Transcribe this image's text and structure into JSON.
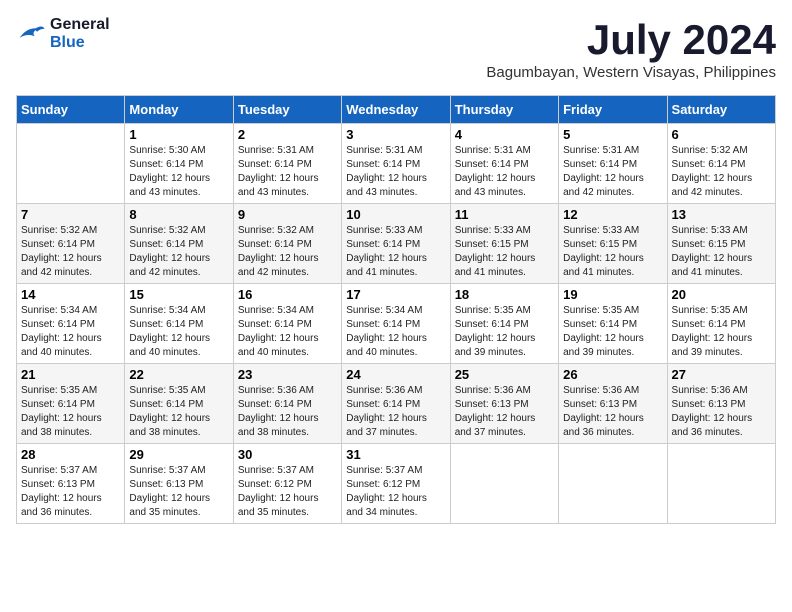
{
  "header": {
    "logo_line1": "General",
    "logo_line2": "Blue",
    "month_title": "July 2024",
    "location": "Bagumbayan, Western Visayas, Philippines"
  },
  "columns": [
    "Sunday",
    "Monday",
    "Tuesday",
    "Wednesday",
    "Thursday",
    "Friday",
    "Saturday"
  ],
  "weeks": [
    [
      {
        "day": "",
        "info": ""
      },
      {
        "day": "1",
        "info": "Sunrise: 5:30 AM\nSunset: 6:14 PM\nDaylight: 12 hours\nand 43 minutes."
      },
      {
        "day": "2",
        "info": "Sunrise: 5:31 AM\nSunset: 6:14 PM\nDaylight: 12 hours\nand 43 minutes."
      },
      {
        "day": "3",
        "info": "Sunrise: 5:31 AM\nSunset: 6:14 PM\nDaylight: 12 hours\nand 43 minutes."
      },
      {
        "day": "4",
        "info": "Sunrise: 5:31 AM\nSunset: 6:14 PM\nDaylight: 12 hours\nand 43 minutes."
      },
      {
        "day": "5",
        "info": "Sunrise: 5:31 AM\nSunset: 6:14 PM\nDaylight: 12 hours\nand 42 minutes."
      },
      {
        "day": "6",
        "info": "Sunrise: 5:32 AM\nSunset: 6:14 PM\nDaylight: 12 hours\nand 42 minutes."
      }
    ],
    [
      {
        "day": "7",
        "info": "Sunrise: 5:32 AM\nSunset: 6:14 PM\nDaylight: 12 hours\nand 42 minutes."
      },
      {
        "day": "8",
        "info": "Sunrise: 5:32 AM\nSunset: 6:14 PM\nDaylight: 12 hours\nand 42 minutes."
      },
      {
        "day": "9",
        "info": "Sunrise: 5:32 AM\nSunset: 6:14 PM\nDaylight: 12 hours\nand 42 minutes."
      },
      {
        "day": "10",
        "info": "Sunrise: 5:33 AM\nSunset: 6:14 PM\nDaylight: 12 hours\nand 41 minutes."
      },
      {
        "day": "11",
        "info": "Sunrise: 5:33 AM\nSunset: 6:15 PM\nDaylight: 12 hours\nand 41 minutes."
      },
      {
        "day": "12",
        "info": "Sunrise: 5:33 AM\nSunset: 6:15 PM\nDaylight: 12 hours\nand 41 minutes."
      },
      {
        "day": "13",
        "info": "Sunrise: 5:33 AM\nSunset: 6:15 PM\nDaylight: 12 hours\nand 41 minutes."
      }
    ],
    [
      {
        "day": "14",
        "info": "Sunrise: 5:34 AM\nSunset: 6:14 PM\nDaylight: 12 hours\nand 40 minutes."
      },
      {
        "day": "15",
        "info": "Sunrise: 5:34 AM\nSunset: 6:14 PM\nDaylight: 12 hours\nand 40 minutes."
      },
      {
        "day": "16",
        "info": "Sunrise: 5:34 AM\nSunset: 6:14 PM\nDaylight: 12 hours\nand 40 minutes."
      },
      {
        "day": "17",
        "info": "Sunrise: 5:34 AM\nSunset: 6:14 PM\nDaylight: 12 hours\nand 40 minutes."
      },
      {
        "day": "18",
        "info": "Sunrise: 5:35 AM\nSunset: 6:14 PM\nDaylight: 12 hours\nand 39 minutes."
      },
      {
        "day": "19",
        "info": "Sunrise: 5:35 AM\nSunset: 6:14 PM\nDaylight: 12 hours\nand 39 minutes."
      },
      {
        "day": "20",
        "info": "Sunrise: 5:35 AM\nSunset: 6:14 PM\nDaylight: 12 hours\nand 39 minutes."
      }
    ],
    [
      {
        "day": "21",
        "info": "Sunrise: 5:35 AM\nSunset: 6:14 PM\nDaylight: 12 hours\nand 38 minutes."
      },
      {
        "day": "22",
        "info": "Sunrise: 5:35 AM\nSunset: 6:14 PM\nDaylight: 12 hours\nand 38 minutes."
      },
      {
        "day": "23",
        "info": "Sunrise: 5:36 AM\nSunset: 6:14 PM\nDaylight: 12 hours\nand 38 minutes."
      },
      {
        "day": "24",
        "info": "Sunrise: 5:36 AM\nSunset: 6:14 PM\nDaylight: 12 hours\nand 37 minutes."
      },
      {
        "day": "25",
        "info": "Sunrise: 5:36 AM\nSunset: 6:13 PM\nDaylight: 12 hours\nand 37 minutes."
      },
      {
        "day": "26",
        "info": "Sunrise: 5:36 AM\nSunset: 6:13 PM\nDaylight: 12 hours\nand 36 minutes."
      },
      {
        "day": "27",
        "info": "Sunrise: 5:36 AM\nSunset: 6:13 PM\nDaylight: 12 hours\nand 36 minutes."
      }
    ],
    [
      {
        "day": "28",
        "info": "Sunrise: 5:37 AM\nSunset: 6:13 PM\nDaylight: 12 hours\nand 36 minutes."
      },
      {
        "day": "29",
        "info": "Sunrise: 5:37 AM\nSunset: 6:13 PM\nDaylight: 12 hours\nand 35 minutes."
      },
      {
        "day": "30",
        "info": "Sunrise: 5:37 AM\nSunset: 6:12 PM\nDaylight: 12 hours\nand 35 minutes."
      },
      {
        "day": "31",
        "info": "Sunrise: 5:37 AM\nSunset: 6:12 PM\nDaylight: 12 hours\nand 34 minutes."
      },
      {
        "day": "",
        "info": ""
      },
      {
        "day": "",
        "info": ""
      },
      {
        "day": "",
        "info": ""
      }
    ]
  ]
}
